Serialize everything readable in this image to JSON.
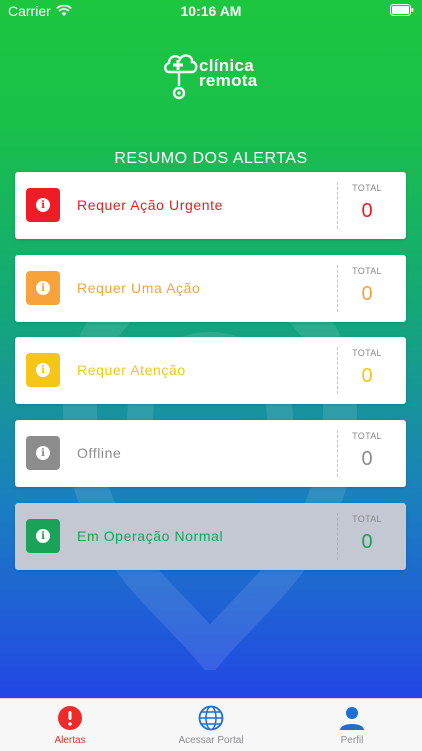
{
  "status_bar": {
    "carrier": "Carrier",
    "time": "10:16 AM"
  },
  "logo": {
    "line1": "clínica",
    "line2": "remota"
  },
  "section_title": "RESUMO DOS ALERTAS",
  "total_label": "TOTAL",
  "alerts": [
    {
      "label": "Requer Ação Urgente",
      "total": "0",
      "color": "#ee1c24"
    },
    {
      "label": "Requer Uma Ação",
      "total": "0",
      "color": "#f7a23b"
    },
    {
      "label": "Requer Atenção",
      "total": "0",
      "color": "#f5c518"
    },
    {
      "label": "Offline",
      "total": "0",
      "color": "#8c8c8c"
    },
    {
      "label": "Em Operação Normal",
      "total": "0",
      "color": "#1aa358"
    }
  ],
  "tabs": [
    {
      "label": "Alertas",
      "icon": "alert-icon",
      "active": true,
      "color": "#ee2b2b"
    },
    {
      "label": "Acessar Portal",
      "icon": "globe-icon",
      "active": false,
      "color": "#1f6fd1"
    },
    {
      "label": "Perfil",
      "icon": "user-icon",
      "active": false,
      "color": "#1f6fd1"
    }
  ]
}
